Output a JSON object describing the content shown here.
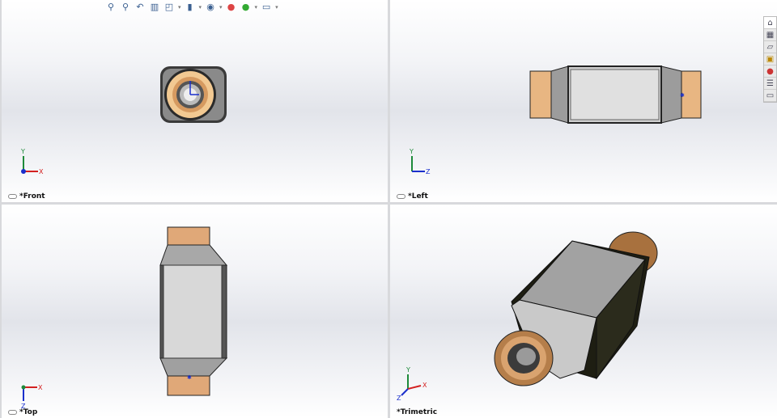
{
  "viewports": [
    {
      "label": "*Front",
      "axes": [
        "Y",
        "X"
      ]
    },
    {
      "label": "*Left",
      "axes": [
        "Y",
        "Z"
      ]
    },
    {
      "label": "*Top",
      "axes": [
        "X",
        "Z"
      ]
    },
    {
      "label": "*Trimetric",
      "axes": [
        "Y",
        "X",
        "Z"
      ]
    }
  ],
  "toolbar": {
    "icons": [
      "zoom-to-fit-icon",
      "zoom-to-area-icon",
      "previous-view-icon",
      "section-view-icon",
      "view-orientation-icon",
      "display-style-icon",
      "hide-show-items-icon",
      "edit-appearance-icon",
      "apply-scene-icon",
      "view-settings-icon"
    ]
  },
  "taskpane": {
    "icons": [
      "home-icon",
      "design-library-icon",
      "file-explorer-icon",
      "view-palette-icon",
      "appearances-icon",
      "custom-properties-icon",
      "forum-icon"
    ]
  },
  "colors": {
    "copper": "#d9a36f",
    "body": "#9a9a9a",
    "dark": "#2b2b2b",
    "x": "#d32020",
    "y": "#1e8a3a",
    "z": "#1a2fcc"
  }
}
